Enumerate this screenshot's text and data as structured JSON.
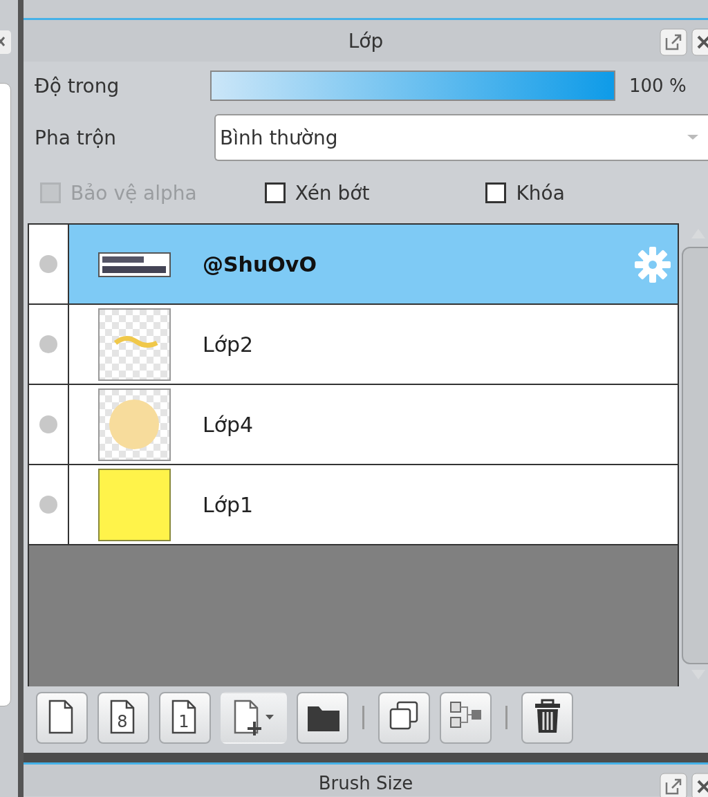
{
  "panel": {
    "title": "Lớp"
  },
  "opacity": {
    "label": "Độ trong",
    "level": 1.0,
    "reading": "100 %"
  },
  "blend": {
    "label": "Pha trộn",
    "value": "Bình thường"
  },
  "options": [
    {
      "label": "Bảo vệ alpha",
      "checked": false,
      "disabled": true
    },
    {
      "label": "Xén bớt",
      "checked": false,
      "disabled": false
    },
    {
      "label": "Khóa",
      "checked": false,
      "disabled": false
    }
  ],
  "layers": [
    {
      "name": "@ShuOvO",
      "selected": true,
      "kind": "text"
    },
    {
      "name": "Lớp2",
      "selected": false,
      "kind": "sketch"
    },
    {
      "name": "Lớp4",
      "selected": false,
      "kind": "circle"
    },
    {
      "name": "Lớp1",
      "selected": false,
      "kind": "fill"
    }
  ],
  "toolbar": [
    {
      "kind": "page"
    },
    {
      "kind": "page-glyph",
      "glyph": "8"
    },
    {
      "kind": "page-glyph",
      "glyph": "1"
    },
    {
      "kind": "add-menu"
    },
    {
      "kind": "folder"
    },
    {
      "kind": "separator"
    },
    {
      "kind": "copy"
    },
    {
      "kind": "merge"
    },
    {
      "kind": "separator"
    },
    {
      "kind": "trash"
    }
  ],
  "next_panel": {
    "title": "Brush Size"
  }
}
